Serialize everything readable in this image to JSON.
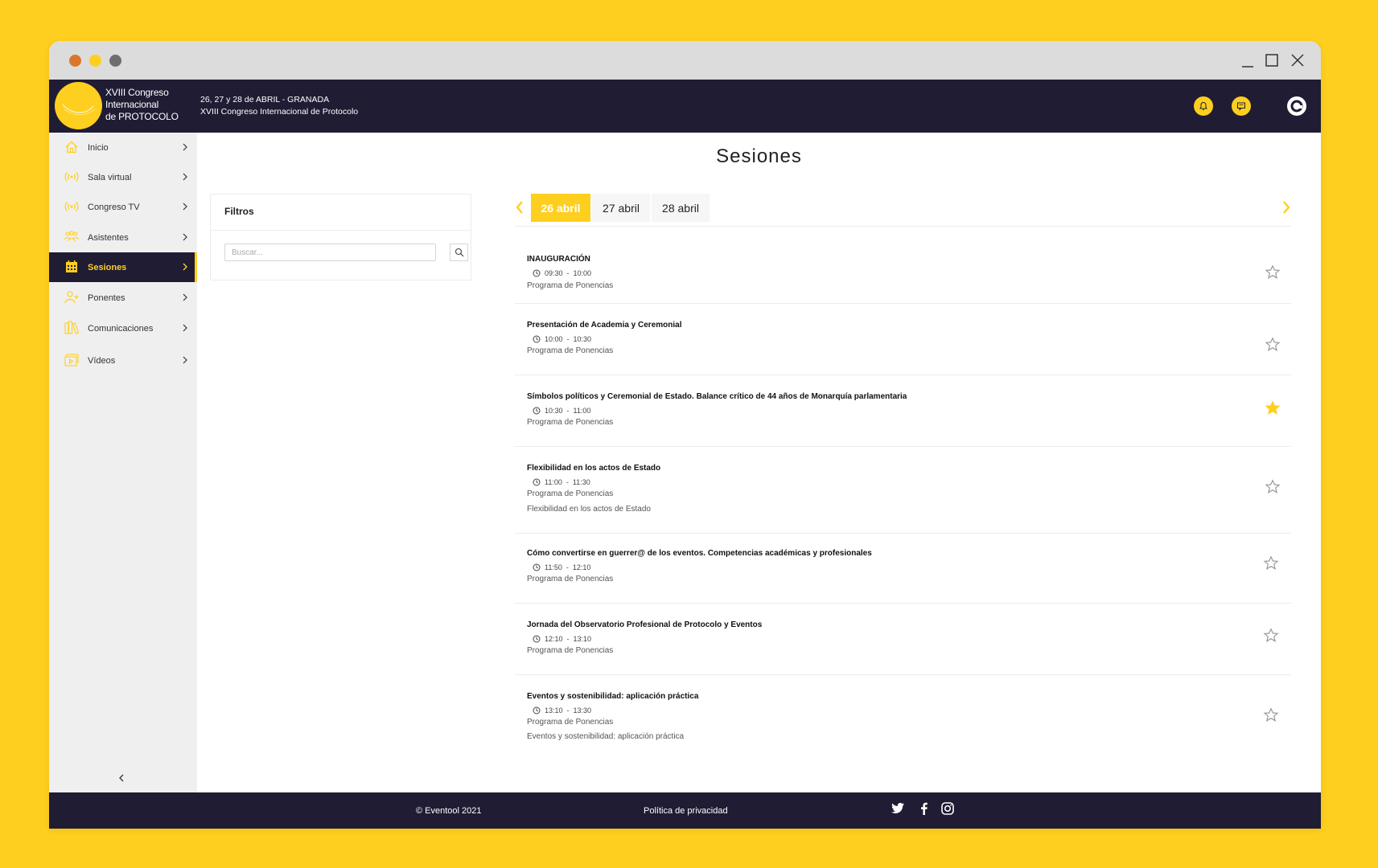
{
  "header": {
    "logo_line1": "XVIII Congreso",
    "logo_line2": "Internacional",
    "logo_line3": "de PROTOCOLO",
    "event_dates": "26, 27 y 28 de ABRIL - GRANADA",
    "event_name": "XVIII Congreso Internacional de Protocolo",
    "icons": [
      "bell-icon",
      "chat-icon",
      "user-avatar"
    ]
  },
  "sidebar": {
    "items": [
      {
        "label": "Inicio",
        "icon": "home-icon"
      },
      {
        "label": "Sala virtual",
        "icon": "broadcast-icon"
      },
      {
        "label": "Congreso TV",
        "icon": "broadcast-icon"
      },
      {
        "label": "Asistentes",
        "icon": "people-icon"
      },
      {
        "label": "Sesiones",
        "icon": "calendar-icon",
        "active": true
      },
      {
        "label": "Ponentes",
        "icon": "add-user-icon"
      },
      {
        "label": "Comunicaciones",
        "icon": "books-icon"
      },
      {
        "label": "Vídeos",
        "icon": "video-gallery-icon"
      }
    ]
  },
  "main": {
    "title": "Sesiones",
    "filters": {
      "title": "Filtros",
      "search_placeholder": "Buscar..."
    },
    "date_tabs": [
      {
        "label": "26 abril",
        "active": true
      },
      {
        "label": "27 abril"
      },
      {
        "label": "28 abril"
      }
    ],
    "sessions": [
      {
        "title": "INAUGURACIÓN",
        "start": "09:30",
        "end": "10:00",
        "program": "Programa de Ponencias",
        "description": "",
        "favorite": false
      },
      {
        "title": "Presentación de Academia y Ceremonial",
        "start": "10:00",
        "end": "10:30",
        "program": "Programa de Ponencias",
        "description": "",
        "favorite": false
      },
      {
        "title": "Símbolos políticos y Ceremonial de Estado. Balance crítico de 44 años de Monarquía parlamentaria",
        "start": "10:30",
        "end": "11:00",
        "program": "Programa de Ponencias",
        "description": "",
        "favorite": true
      },
      {
        "title": "Flexibilidad en los actos de Estado",
        "start": "11:00",
        "end": "11:30",
        "program": "Programa de Ponencias",
        "description": "Flexibilidad en los actos de Estado",
        "favorite": false
      },
      {
        "title": "Cómo convertirse en guerrer@ de los eventos. Competencias académicas y profesionales",
        "start": "11:50",
        "end": "12:10",
        "program": "Programa de Ponencias",
        "description": "",
        "favorite": false
      },
      {
        "title": "Jornada del Observatorio Profesional de Protocolo y Eventos",
        "start": "12:10",
        "end": "13:10",
        "program": "Programa de Ponencias",
        "description": "",
        "favorite": false
      },
      {
        "title": "Eventos y sostenibilidad: aplicación práctica",
        "start": "13:10",
        "end": "13:30",
        "program": "Programa de Ponencias",
        "description": "Eventos y sostenibilidad: aplicación práctica",
        "favorite": false
      }
    ]
  },
  "footer": {
    "copyright": "© Eventool 2021",
    "privacy": "Política de privacidad",
    "social": [
      "twitter-icon",
      "facebook-icon",
      "instagram-icon"
    ]
  },
  "colors": {
    "brand_yellow": "#fecf1f",
    "navy": "#1f1c33"
  }
}
